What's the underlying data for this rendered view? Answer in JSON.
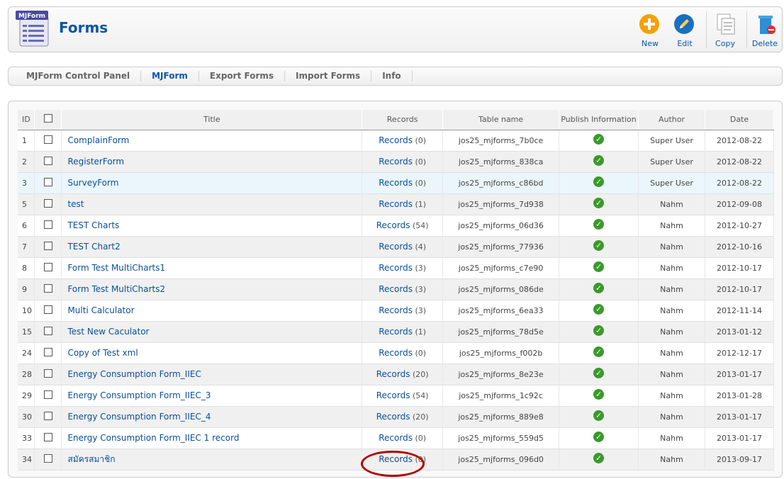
{
  "header": {
    "logo_text": "MJForm",
    "title": "Forms",
    "buttons": [
      {
        "label": "New",
        "icon": "plus-icon"
      },
      {
        "label": "Edit",
        "icon": "pencil-icon"
      },
      {
        "label": "Copy",
        "icon": "copy-icon"
      },
      {
        "label": "Delete",
        "icon": "trash-icon"
      }
    ]
  },
  "submenu": {
    "items": [
      {
        "label": "MJForm Control Panel"
      },
      {
        "label": "MJForm",
        "active": true
      },
      {
        "label": "Export Forms"
      },
      {
        "label": "Import Forms"
      },
      {
        "label": "Info"
      }
    ]
  },
  "table": {
    "columns": [
      "ID",
      "",
      "Title",
      "Records",
      "Table name",
      "Publish Information",
      "Author",
      "Date"
    ],
    "records_label": "Records",
    "rows": [
      {
        "id": "1",
        "title": "ComplainForm",
        "records": "(0)",
        "table": "jos25_mjforms_7b0ce",
        "author": "Super User",
        "date": "2012-08-22"
      },
      {
        "id": "2",
        "title": "RegisterForm",
        "records": "(0)",
        "table": "jos25_mjforms_838ca",
        "author": "Super User",
        "date": "2012-08-22"
      },
      {
        "id": "3",
        "title": "SurveyForm",
        "records": "(0)",
        "table": "jos25_mjforms_c86bd",
        "author": "Super User",
        "date": "2012-08-22"
      },
      {
        "id": "5",
        "title": "test",
        "records": "(1)",
        "table": "jos25_mjforms_7d938",
        "author": "Nahm",
        "date": "2012-09-08"
      },
      {
        "id": "6",
        "title": "TEST Charts",
        "records": "(54)",
        "table": "jos25_mjforms_06d36",
        "author": "Nahm",
        "date": "2012-10-27"
      },
      {
        "id": "7",
        "title": "TEST Chart2",
        "records": "(4)",
        "table": "jos25_mjforms_77936",
        "author": "Nahm",
        "date": "2012-10-16"
      },
      {
        "id": "8",
        "title": "Form Test MultiCharts1",
        "records": "(3)",
        "table": "jos25_mjforms_c7e90",
        "author": "Nahm",
        "date": "2012-10-17"
      },
      {
        "id": "9",
        "title": "Form Test MultiCharts2",
        "records": "(3)",
        "table": "jos25_mjforms_086de",
        "author": "Nahm",
        "date": "2012-10-17"
      },
      {
        "id": "10",
        "title": "Multi Calculator",
        "records": "(3)",
        "table": "jos25_mjforms_6ea33",
        "author": "Nahm",
        "date": "2012-11-14"
      },
      {
        "id": "15",
        "title": "Test New Caculator",
        "records": "(1)",
        "table": "jos25_mjforms_78d5e",
        "author": "Nahm",
        "date": "2013-01-12"
      },
      {
        "id": "24",
        "title": "Copy of Test xml",
        "records": "(0)",
        "table": "jos25_mjforms_f002b",
        "author": "Nahm",
        "date": "2012-12-17"
      },
      {
        "id": "28",
        "title": "Energy Consumption Form_IIEC",
        "records": "(20)",
        "table": "jos25_mjforms_8e23e",
        "author": "Nahm",
        "date": "2013-01-17"
      },
      {
        "id": "29",
        "title": "Energy Consumption Form_IIEC_3",
        "records": "(54)",
        "table": "jos25_mjforms_1c92c",
        "author": "Nahm",
        "date": "2013-01-28"
      },
      {
        "id": "30",
        "title": "Energy Consumption Form_IIEC_4",
        "records": "(20)",
        "table": "jos25_mjforms_889e8",
        "author": "Nahm",
        "date": "2013-01-17"
      },
      {
        "id": "33",
        "title": "Energy Consumption Form_IIEC 1 record",
        "records": "(0)",
        "table": "jos25_mjforms_559d5",
        "author": "Nahm",
        "date": "2013-01-17"
      },
      {
        "id": "34",
        "title": "สมัครสมาชิก",
        "records": "(0)",
        "table": "jos25_mjforms_096d0",
        "author": "Nahm",
        "date": "2013-09-17"
      }
    ]
  },
  "colors": {
    "accent": "#0b55a4",
    "publish": "#3a9a2a",
    "highlight": "#b00000"
  }
}
